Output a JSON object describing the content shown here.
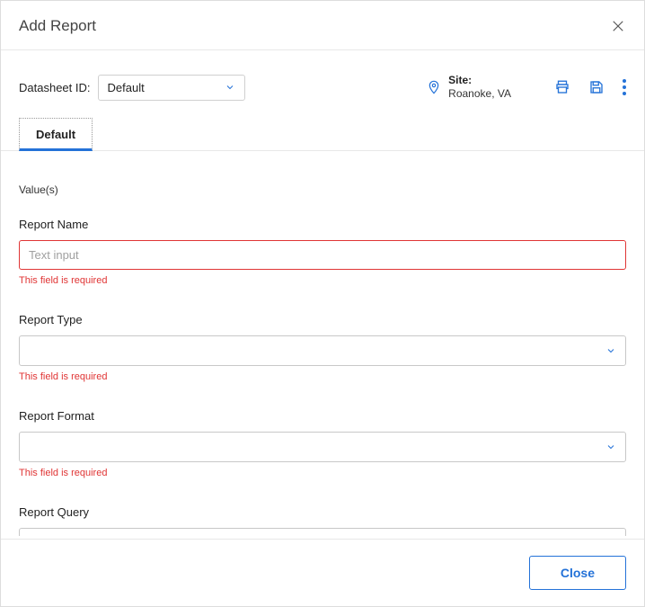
{
  "header": {
    "title": "Add Report"
  },
  "datasheet": {
    "label": "Datasheet ID:",
    "selected": "Default"
  },
  "site": {
    "label": "Site:",
    "value": "Roanoke, VA"
  },
  "tabs": {
    "default": "Default"
  },
  "section": {
    "values_label": "Value(s)"
  },
  "fields": {
    "report_name": {
      "label": "Report Name",
      "placeholder": "Text input",
      "error": "This field is required"
    },
    "report_type": {
      "label": "Report Type",
      "value": "",
      "error": "This field is required"
    },
    "report_format": {
      "label": "Report Format",
      "value": "",
      "error": "This field is required"
    },
    "report_query": {
      "label": "Report Query",
      "value": ""
    }
  },
  "footer": {
    "close_label": "Close"
  }
}
